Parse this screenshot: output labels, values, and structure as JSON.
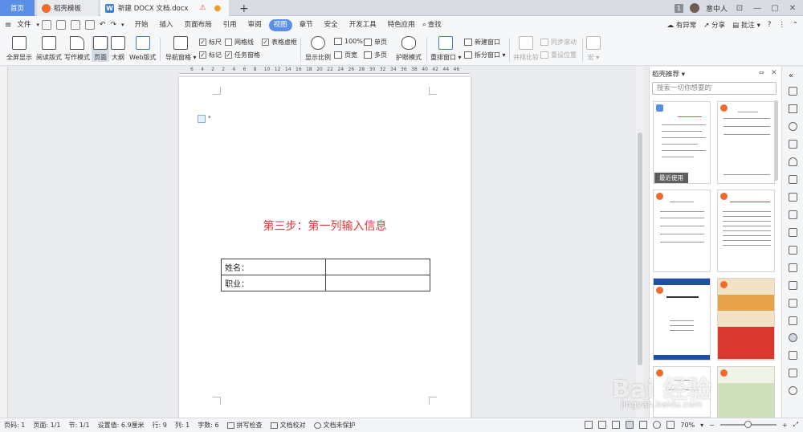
{
  "tabs": {
    "home": "首页",
    "templates": "稻壳模板",
    "document": "新建 DOCX 文档.docx",
    "new_tab": "+"
  },
  "titlebar": {
    "badge": "1",
    "user": "意中人"
  },
  "menu": {
    "file": "文件",
    "items": [
      "开始",
      "插入",
      "页面布局",
      "引用",
      "审阅",
      "视图",
      "章节",
      "安全",
      "开发工具",
      "特色应用"
    ],
    "active": "视图",
    "search": "查找",
    "right": {
      "issues": "有异常",
      "share": "分享",
      "comment": "批注"
    }
  },
  "ribbon": {
    "fullscreen": "全屏显示",
    "reading": "阅读版式",
    "writing": "写作模式",
    "page": "页面",
    "outline": "大纲",
    "web": "Web版式",
    "nav": "导航窗格",
    "checks": [
      {
        "label": "标尺",
        "checked": true
      },
      {
        "label": "网格线",
        "checked": false
      },
      {
        "label": "表格虚框",
        "checked": true
      },
      {
        "label": "标记",
        "checked": true
      },
      {
        "label": "任务窗格",
        "checked": true
      }
    ],
    "zoom": "显示比例",
    "zoom100": "100%",
    "single": "单页",
    "pagewidth": "页宽",
    "multi": "多页",
    "eye": "护眼模式",
    "rearrange": "重排窗口",
    "newwin": "新建窗口",
    "split": "拆分窗口",
    "compare": "并排比较",
    "sync": "同步滚动",
    "reset": "重设位置",
    "macro": "宏"
  },
  "ruler": [
    "6",
    "4",
    "2",
    "2",
    "4",
    "6",
    "8",
    "10",
    "12",
    "14",
    "16",
    "18",
    "20",
    "22",
    "24",
    "26",
    "28",
    "30",
    "32",
    "34",
    "36",
    "38",
    "40",
    "42",
    "44",
    "46"
  ],
  "document": {
    "heading": "第三步：第一列输入信息",
    "table": [
      [
        "姓名：",
        ""
      ],
      [
        "职业：",
        ""
      ]
    ]
  },
  "panel": {
    "title": "稻壳推荐",
    "search_placeholder": "搜索一切你想要的",
    "recent": "最近使用"
  },
  "status": {
    "page_num": "页码: 1",
    "pages": "页面: 1/1",
    "section": "节: 1/1",
    "setting": "设置值: 6.9厘米",
    "row": "行: 9",
    "col": "列: 1",
    "words": "字数: 6",
    "spell": "拼写检查",
    "proof": "文档校对",
    "protect": "文档未保护",
    "zoom": "70%"
  },
  "watermark": {
    "text": "Bai 经验",
    "url": "jingyan.baidu.com"
  },
  "colors": {
    "accent": "#5b8ee6",
    "heading": "#e03a3a"
  }
}
